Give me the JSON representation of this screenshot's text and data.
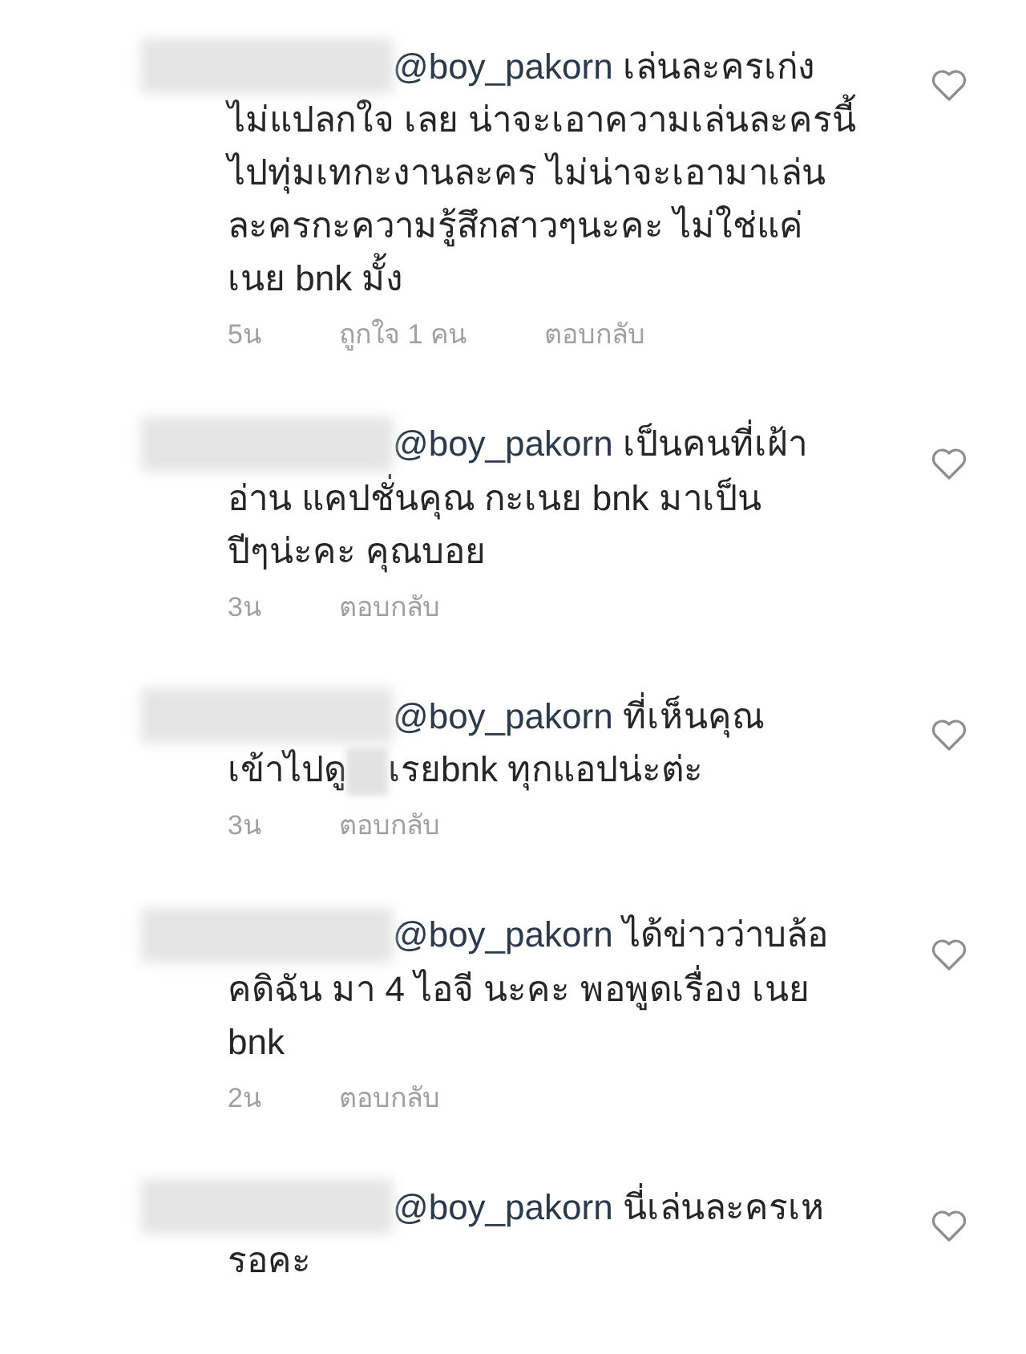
{
  "comments": [
    {
      "mention": "@boy_pakorn",
      "lines": [
        [
          {
            "kind": "text",
            "text": "เล่นละครเก่ง"
          }
        ],
        [
          {
            "kind": "text",
            "text": "ไม่แปลกใจ เลย น่าจะเอาความเล่นละครนี้"
          }
        ],
        [
          {
            "kind": "text",
            "text": "ไปทุ่มเทกะงานละคร ไม่น่าจะเอามาเล่น"
          }
        ],
        [
          {
            "kind": "text",
            "text": "ละครกะความรู้สึกสาวๆนะคะ ไม่ใช่แค่"
          }
        ],
        [
          {
            "kind": "text",
            "text": "เนย bnk มั้ง"
          }
        ]
      ],
      "time": "5น",
      "likes": "ถูกใจ 1 คน",
      "reply": "ตอบกลับ",
      "liked": false
    },
    {
      "mention": "@boy_pakorn",
      "lines": [
        [
          {
            "kind": "text",
            "text": "เป็นคนที่เฝ้า"
          }
        ],
        [
          {
            "kind": "text",
            "text": "อ่าน แคปชั่นคุณ กะเนย bnk มาเป็น"
          }
        ],
        [
          {
            "kind": "text",
            "text": "ปีๆน่ะคะ คุณบอย"
          }
        ]
      ],
      "time": "3น",
      "reply": "ตอบกลับ",
      "liked": false
    },
    {
      "mention": "@boy_pakorn",
      "lines": [
        [
          {
            "kind": "text",
            "text": "ที่เห็นคุณ"
          }
        ],
        [
          {
            "kind": "text",
            "text": "เข้าไปดู"
          },
          {
            "kind": "redacted"
          },
          {
            "kind": "text",
            "text": "เรยbnk ทุกแอปน่ะต่ะ"
          }
        ]
      ],
      "time": "3น",
      "reply": "ตอบกลับ",
      "liked": false
    },
    {
      "mention": "@boy_pakorn",
      "lines": [
        [
          {
            "kind": "text",
            "text": "ได้ข่าวว่าบล้อ"
          }
        ],
        [
          {
            "kind": "text",
            "text": "คดิฉัน มา 4 ไอจี นะคะ พอพูดเรื่อง เนย"
          }
        ],
        [
          {
            "kind": "text",
            "text": "bnk"
          }
        ]
      ],
      "time": "2น",
      "reply": "ตอบกลับ",
      "liked": false
    },
    {
      "mention": "@boy_pakorn",
      "lines": [
        [
          {
            "kind": "text",
            "text": "นี่เล่นละครเห"
          }
        ],
        [
          {
            "kind": "text",
            "text": "รอคะ"
          }
        ]
      ],
      "liked": false
    }
  ]
}
